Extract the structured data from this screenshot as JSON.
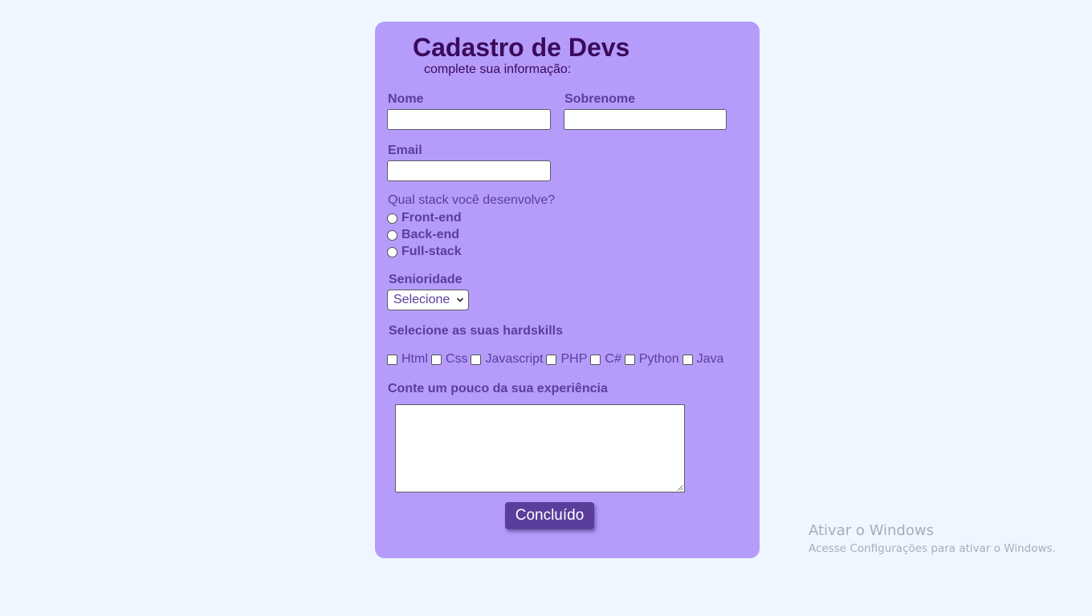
{
  "form": {
    "title": "Cadastro de Devs",
    "subtitle": "complete sua informação:",
    "nome_label": "Nome",
    "sobrenome_label": "Sobrenome",
    "email_label": "Email",
    "stack_question": "Qual stack você desenvolve?",
    "stack_options": [
      {
        "label": "Front-end"
      },
      {
        "label": "Back-end"
      },
      {
        "label": "Full-stack"
      }
    ],
    "senioridade_label": "Senioridade",
    "senioridade_selected": "Selecione",
    "hardskills_label": "Selecione as suas hardskills",
    "hardskills": [
      {
        "label": "Html"
      },
      {
        "label": "Css"
      },
      {
        "label": "Javascript"
      },
      {
        "label": "PHP"
      },
      {
        "label": "C#"
      },
      {
        "label": "Python"
      },
      {
        "label": "Java"
      }
    ],
    "experiencia_label": "Conte um pouco da sua experiência",
    "submit_label": "Concluído"
  },
  "windows_watermark": {
    "title": "Ativar o Windows",
    "subtitle": "Acesse Configurações para ativar o Windows."
  },
  "colors": {
    "page_background": "#eff6ff",
    "card_background": "#b59cfa",
    "title_color": "#3a0a5c",
    "label_color": "#5b3d9c",
    "button_color": "#5b3d9c"
  }
}
